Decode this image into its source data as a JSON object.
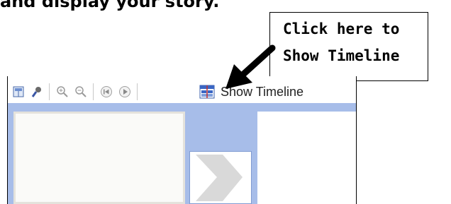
{
  "instruction": {
    "text": "and display your story."
  },
  "callout": {
    "line1": "Click here to",
    "line2": "Show Timeline"
  },
  "toolbar": {
    "show_timeline_label": "Show Timeline",
    "icons": [
      "storyboard-icon",
      "voice-narration-icon",
      "zoom-in-icon",
      "zoom-out-icon",
      "rewind-icon",
      "play-icon",
      "timeline-icon"
    ]
  },
  "colors": {
    "pane_blue": "#a7bde9",
    "toolbar_bg": "#ffffff",
    "slide_border": "#e4e2dc"
  }
}
